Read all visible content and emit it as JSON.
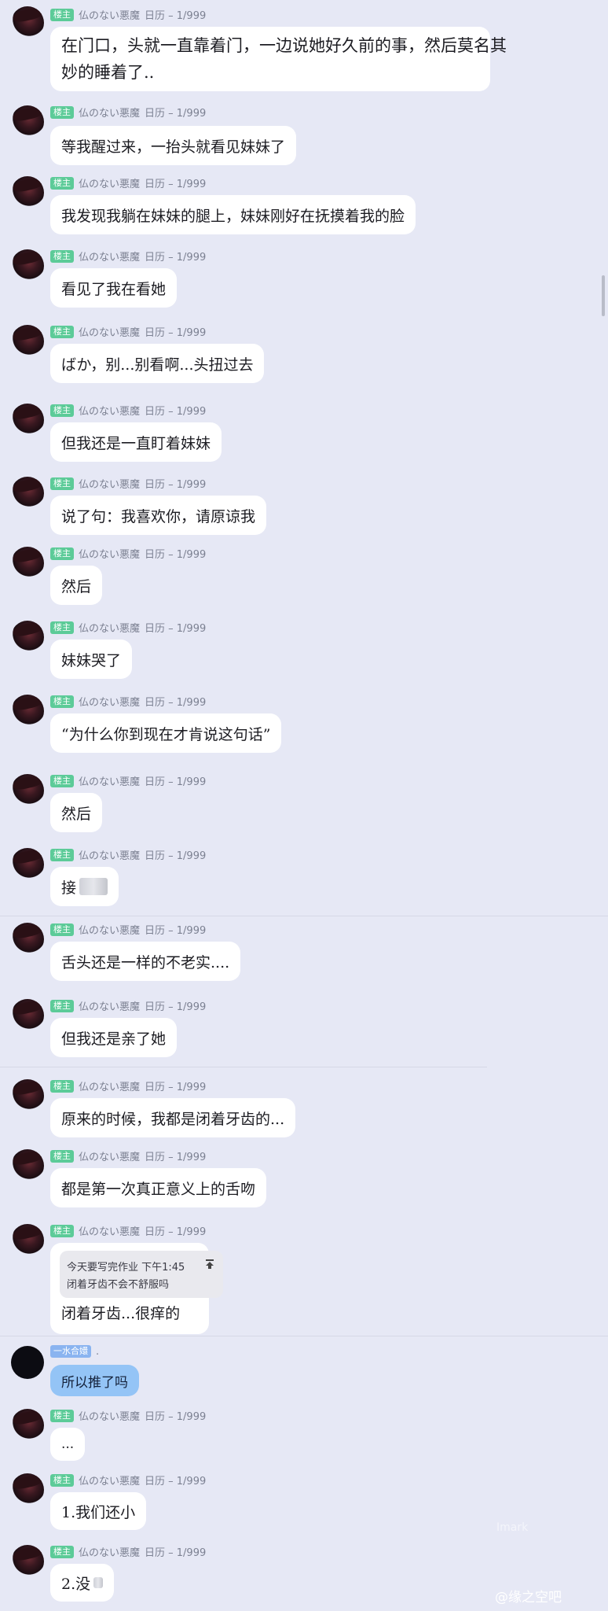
{
  "meta": {
    "badge": "楼主",
    "name": "仏のない悪魔",
    "floor": "日历 – 1/999"
  },
  "reply": {
    "badge": "一水合嬛",
    "name": "."
  },
  "messages": [
    {
      "text_line1": "在门口，头就一直靠着门，一边说她好久前的事，然后莫名其",
      "text_line2": "妙的睡着了.."
    },
    {
      "text": "等我醒过来，一抬头就看见妹妹了"
    },
    {
      "text": "我发现我躺在妹妹的腿上，妹妹刚好在抚摸着我的脸"
    },
    {
      "text": "看见了我在看她"
    },
    {
      "text": "ばか，别...别看啊...头扭过去"
    },
    {
      "text": "但我还是一直盯着妹妹"
    },
    {
      "text": "说了句：我喜欢你，请原谅我"
    },
    {
      "text": "然后"
    },
    {
      "text": "妹妹哭了"
    },
    {
      "text": "“为什么你到现在才肯说这句话”"
    },
    {
      "text": "然后"
    },
    {
      "text": "接"
    },
    {
      "text": "舌头还是一样的不老实...."
    },
    {
      "text": "但我还是亲了她"
    },
    {
      "text": "原来的时候，我都是闭着牙齿的..."
    },
    {
      "text": "都是第一次真正意义上的舌吻"
    },
    {
      "quote_line1": "今天要写完作业 下午1:45",
      "quote_line2": "闭着牙齿不会不舒服吗",
      "text": "闭着牙齿...很痒的"
    },
    {
      "text": "所以推了吗"
    },
    {
      "text": "..."
    },
    {
      "text": "1.我们还小"
    },
    {
      "text": "2.没"
    }
  ],
  "watermarks": {
    "mark1": "Imark",
    "mark2": "@缘之空吧"
  },
  "icons": {
    "pin": "pin-top-icon",
    "avatar": "avatar-image"
  }
}
